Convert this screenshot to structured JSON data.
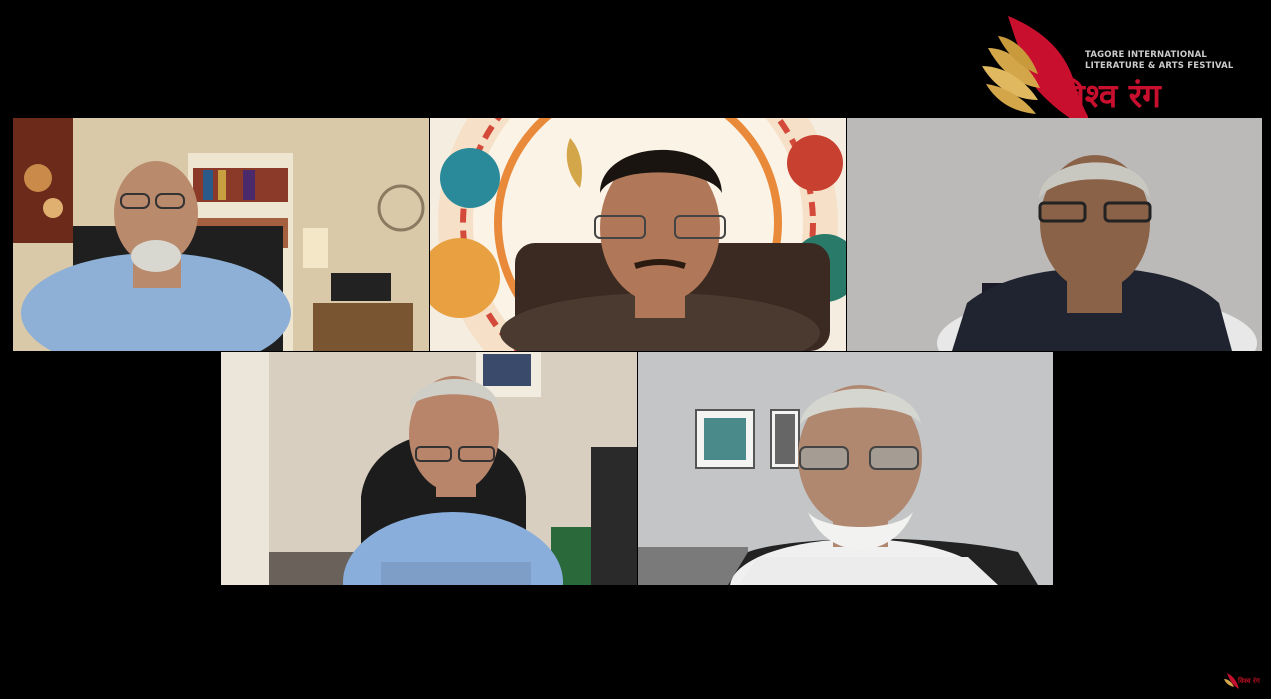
{
  "app": {
    "type": "video-conference-recording"
  },
  "logo": {
    "line1": "TAGORE INTERNATIONAL",
    "line2": "LITERATURE & ARTS FESTIVAL",
    "title": "विश्व रंग",
    "icon": "wing-flame-icon"
  },
  "corner_logo": {
    "title": "विश्व रंग",
    "icon": "wing-flame-icon"
  },
  "colors": {
    "background": "#000000",
    "brand_red": "#c8102e",
    "brand_gold": "#d4a64a"
  },
  "participants": [
    {
      "id": "p1",
      "background": "home-office-bookshelf"
    },
    {
      "id": "p2",
      "background": "festival-mandala-backdrop"
    },
    {
      "id": "p3",
      "background": "plain-grey-wall"
    },
    {
      "id": "p4",
      "background": "home-office-door"
    },
    {
      "id": "p5",
      "background": "office-wall-frames"
    }
  ]
}
